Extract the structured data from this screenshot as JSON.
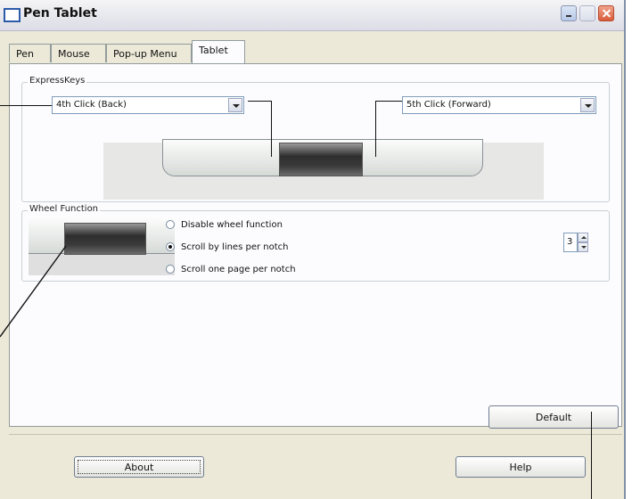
{
  "window": {
    "title": "Pen Tablet"
  },
  "tabs": [
    {
      "label": "Pen",
      "active": false
    },
    {
      "label": "Mouse",
      "active": false
    },
    {
      "label": "Pop-up Menu",
      "active": false
    },
    {
      "label": "Tablet",
      "active": true
    }
  ],
  "express_keys": {
    "group_label": "ExpressKeys",
    "left_key": {
      "selected": "4th Click (Back)"
    },
    "right_key": {
      "selected": "5th Click (Forward)"
    }
  },
  "wheel": {
    "group_label": "Wheel Function",
    "options": [
      {
        "label": "Disable wheel function",
        "checked": false
      },
      {
        "label": "Scroll by lines per notch",
        "checked": true
      },
      {
        "label": "Scroll one page per notch",
        "checked": false
      }
    ],
    "lines_value": "3"
  },
  "buttons": {
    "default": "Default",
    "about": "About",
    "help": "Help"
  }
}
